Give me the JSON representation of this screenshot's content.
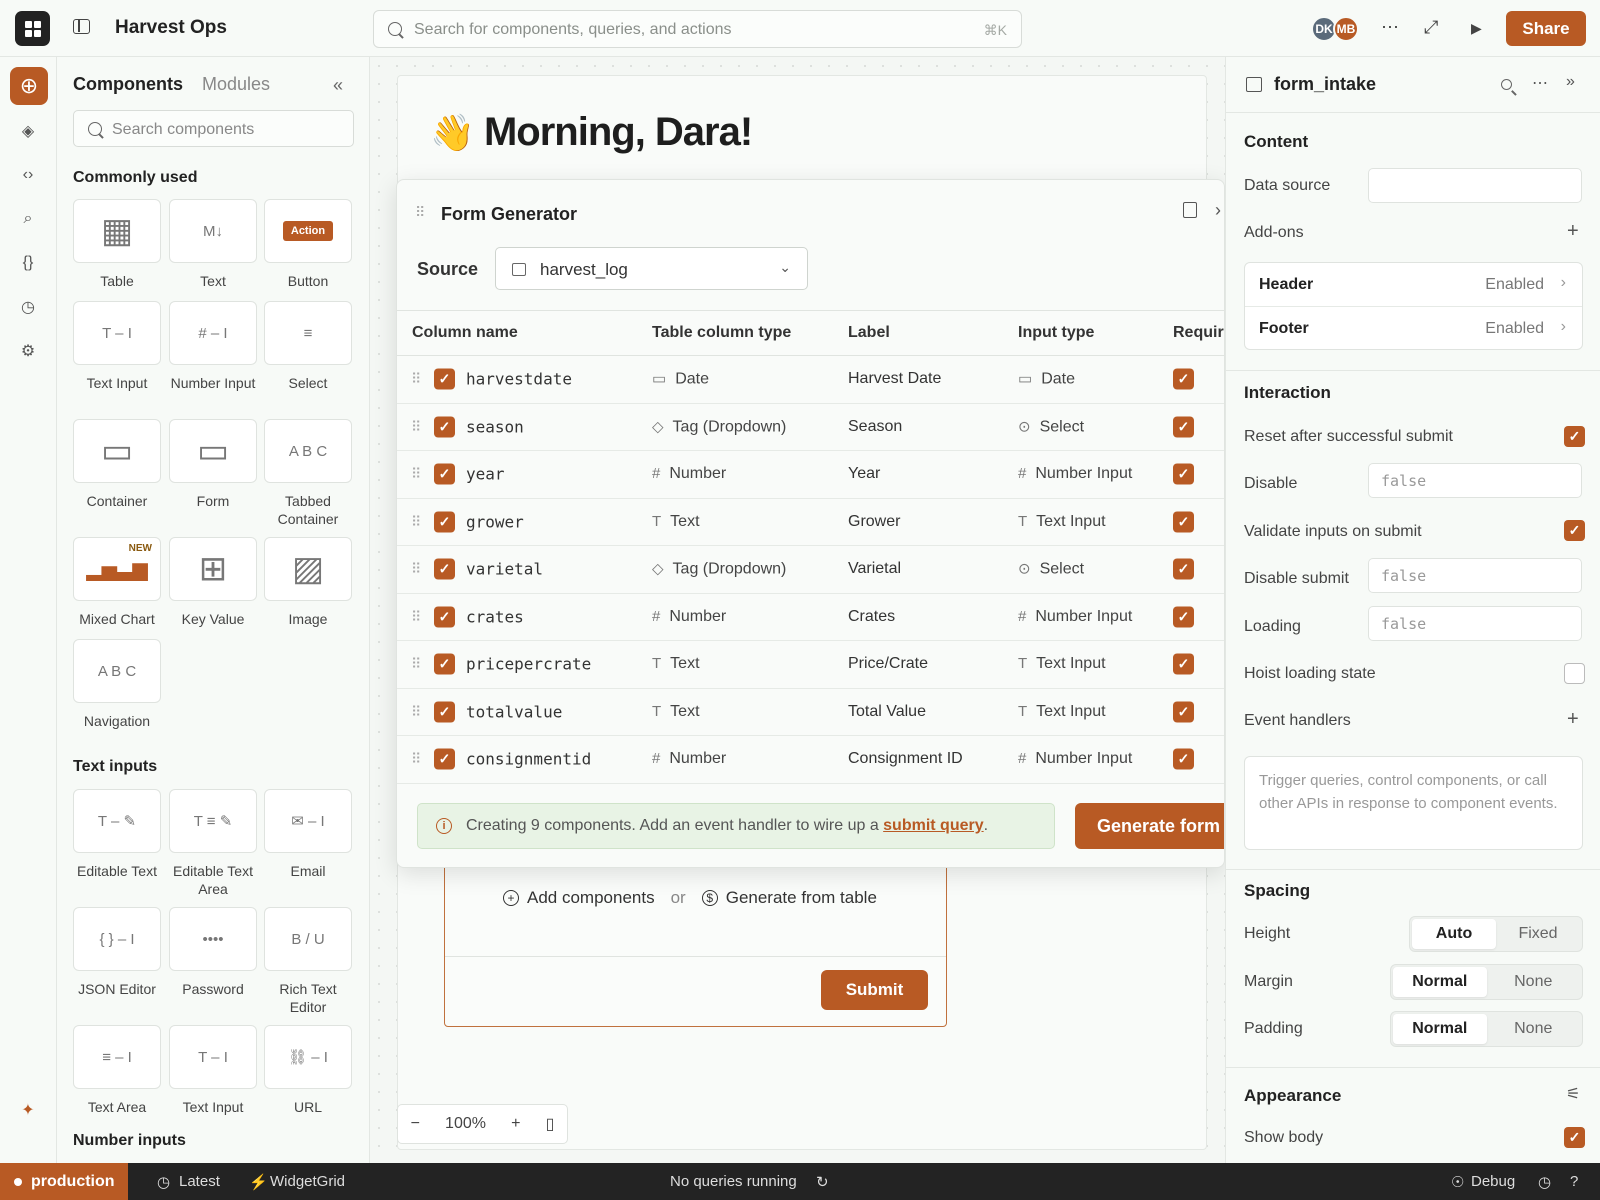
{
  "topbar": {
    "app_title": "Harvest Ops",
    "search_placeholder": "Search for components, queries, and actions",
    "search_shortcut": "⌘K",
    "avatars": [
      {
        "initials": "DK",
        "color": "#5a6a7a"
      },
      {
        "initials": "MB",
        "color": "#b85a24"
      }
    ],
    "share_label": "Share"
  },
  "left_panel": {
    "tabs": [
      "Components",
      "Modules"
    ],
    "search_placeholder": "Search components",
    "sections": {
      "common": "Commonly used",
      "text_inputs": "Text inputs",
      "number_inputs": "Number inputs"
    },
    "common": [
      {
        "label": "Table",
        "glyph": "▦"
      },
      {
        "label": "Text",
        "glyph": "M↓"
      },
      {
        "label": "Button",
        "glyph": "Action"
      },
      {
        "label": "Text Input",
        "glyph": "T – I"
      },
      {
        "label": "Number Input",
        "glyph": "# – I"
      },
      {
        "label": "Select",
        "glyph": "≡"
      },
      {
        "label": "Container",
        "glyph": "▭"
      },
      {
        "label": "Form",
        "glyph": "▭"
      },
      {
        "label": "Tabbed Container",
        "glyph": "A B C"
      },
      {
        "label": "Mixed Chart",
        "glyph": "▂▅▃▆",
        "badge": "NEW"
      },
      {
        "label": "Key Value",
        "glyph": "⊞"
      },
      {
        "label": "Image",
        "glyph": "▨"
      },
      {
        "label": "Navigation",
        "glyph": "A B C"
      }
    ],
    "text_inputs": [
      {
        "label": "Editable Text",
        "glyph": "T – ✎"
      },
      {
        "label": "Editable Text Area",
        "glyph": "T ≡ ✎"
      },
      {
        "label": "Email",
        "glyph": "✉ – I"
      },
      {
        "label": "JSON Editor",
        "glyph": "{ } – I"
      },
      {
        "label": "Password",
        "glyph": "••••"
      },
      {
        "label": "Rich Text Editor",
        "glyph": "B / U"
      },
      {
        "label": "Text Area",
        "glyph": "≡ – I"
      },
      {
        "label": "Text Input",
        "glyph": "T – I"
      },
      {
        "label": "URL",
        "glyph": "⛓ – I"
      }
    ]
  },
  "canvas": {
    "greeting_emoji": "👋",
    "greeting": "Morning, Dara!",
    "add_components": "Add components",
    "or": "or",
    "generate_from_table": "Generate from table",
    "submit_label": "Submit",
    "zoom": "100%"
  },
  "modal": {
    "title": "Form Generator",
    "source_label": "Source",
    "source_value": "harvest_log",
    "columns": [
      "Column name",
      "Table column type",
      "Label",
      "Input type",
      "Required"
    ],
    "rows": [
      {
        "name": "harvestdate",
        "type": "Date",
        "type_icon": "▭",
        "label": "Harvest Date",
        "input": "Date",
        "input_icon": "▭"
      },
      {
        "name": "season",
        "type": "Tag (Dropdown)",
        "type_icon": "◇",
        "label": "Season",
        "input": "Select",
        "input_icon": "⊙"
      },
      {
        "name": "year",
        "type": "Number",
        "type_icon": "#",
        "label": "Year",
        "input": "Number Input",
        "input_icon": "#"
      },
      {
        "name": "grower",
        "type": "Text",
        "type_icon": "T",
        "label": "Grower",
        "input": "Text Input",
        "input_icon": "T"
      },
      {
        "name": "varietal",
        "type": "Tag (Dropdown)",
        "type_icon": "◇",
        "label": "Varietal",
        "input": "Select",
        "input_icon": "⊙"
      },
      {
        "name": "crates",
        "type": "Number",
        "type_icon": "#",
        "label": "Crates",
        "input": "Number Input",
        "input_icon": "#"
      },
      {
        "name": "pricepercrate",
        "type": "Text",
        "type_icon": "T",
        "label": "Price/Crate",
        "input": "Text Input",
        "input_icon": "T"
      },
      {
        "name": "totalvalue",
        "type": "Text",
        "type_icon": "T",
        "label": "Total Value",
        "input": "Text Input",
        "input_icon": "T"
      },
      {
        "name": "consignmentid",
        "type": "Number",
        "type_icon": "#",
        "label": "Consignment ID",
        "input": "Number Input",
        "input_icon": "#"
      }
    ],
    "info_prefix": "Creating 9 components. Add an event handler to wire up a ",
    "info_link": "submit query",
    "info_suffix": ".",
    "generate_label": "Generate form"
  },
  "right_panel": {
    "title": "form_intake",
    "content_heading": "Content",
    "data_source_label": "Data source",
    "addons_label": "Add-ons",
    "header_label": "Header",
    "header_value": "Enabled",
    "footer_label": "Footer",
    "footer_value": "Enabled",
    "interaction_heading": "Interaction",
    "reset_label": "Reset after successful submit",
    "disable_label": "Disable",
    "disable_value": "false",
    "validate_label": "Validate inputs on submit",
    "disable_submit_label": "Disable submit",
    "disable_submit_value": "false",
    "loading_label": "Loading",
    "loading_value": "false",
    "hoist_label": "Hoist loading state",
    "event_handlers_label": "Event handlers",
    "event_help": "Trigger queries, control components, or call other APIs in response to component events.",
    "spacing_heading": "Spacing",
    "height_label": "Height",
    "height_options": [
      "Auto",
      "Fixed"
    ],
    "margin_label": "Margin",
    "margin_options": [
      "Normal",
      "None"
    ],
    "padding_label": "Padding",
    "padding_options": [
      "Normal",
      "None"
    ],
    "appearance_heading": "Appearance",
    "show_body_label": "Show body"
  },
  "statusbar": {
    "env": "production",
    "branch": "Latest",
    "widget": "WidgetGrid",
    "queries": "No queries running",
    "debug": "Debug"
  },
  "colors": {
    "accent": "#b85a24",
    "info_bg": "#e8f3e5",
    "status_bg": "#232323"
  }
}
